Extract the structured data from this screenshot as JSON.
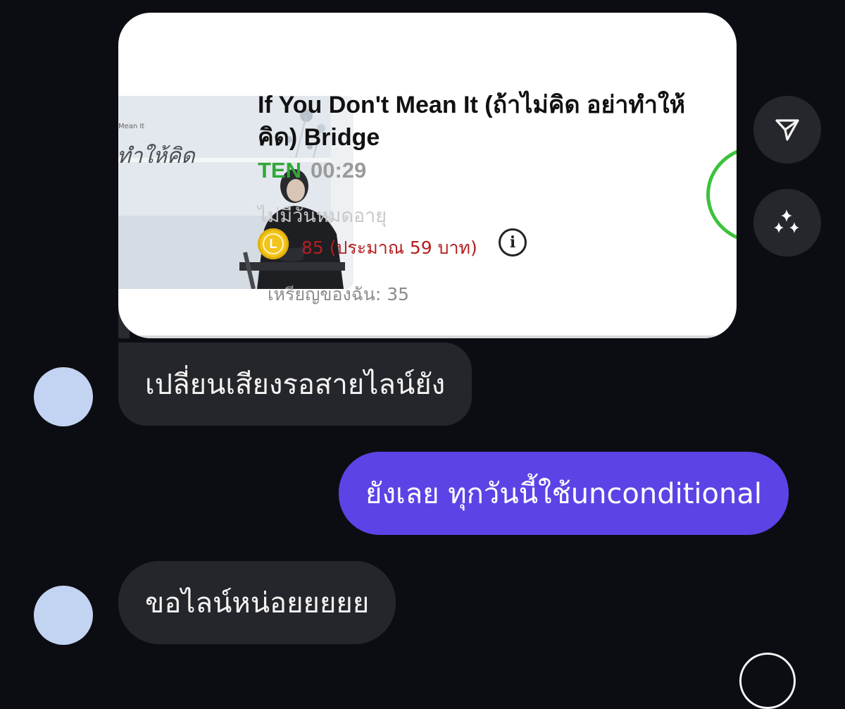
{
  "shared_card": {
    "title": "If You Don't Mean It (ถ้าไม่คิด อย่าทำให้คิด) Bridge",
    "artist": "TEN",
    "duration": "00:29",
    "expiry": "ไม่มีวันหมดอายุ",
    "coin_letter": "L",
    "price": "85 (ประมาณ 59 บาท)",
    "balance": "เหรียญของฉัน: 35",
    "thumb_caption_small": "Mean It",
    "thumb_caption_script": "ทำให้คิด"
  },
  "actions": {
    "share_icon": "send-icon",
    "ai_icon": "sparkles-icon"
  },
  "messages": [
    {
      "direction": "incoming",
      "text": "เปลี่ยนเสียงรอสายไลน์ยัง"
    },
    {
      "direction": "outgoing",
      "text": "ยังเลย ทุกวันนี้ใช้unconditional"
    },
    {
      "direction": "incoming",
      "text": "ขอไลน์หน่อยยยยย"
    }
  ],
  "colors": {
    "background": "#0c0d12",
    "incoming_bubble": "#25262b",
    "outgoing_bubble": "#5b44e6",
    "artist_green": "#30a837",
    "price_red": "#b21f1f",
    "avatar": "#c3d3f2"
  }
}
